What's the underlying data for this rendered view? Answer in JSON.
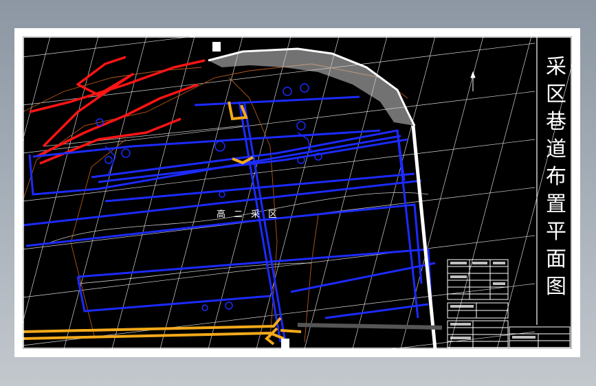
{
  "drawing": {
    "title": "采区巷道布置平面图",
    "area_label": "高二采区"
  },
  "colors": {
    "background": "#000000",
    "roadway_blue": "#1c2bff",
    "haulage_orange": "#f3a91a",
    "fault_red": "#ff1414",
    "grid": "#ffffff",
    "contour_brown": "#b85a1a",
    "sheet_border": "#ffffff",
    "desktop": "#9aa4ae"
  }
}
